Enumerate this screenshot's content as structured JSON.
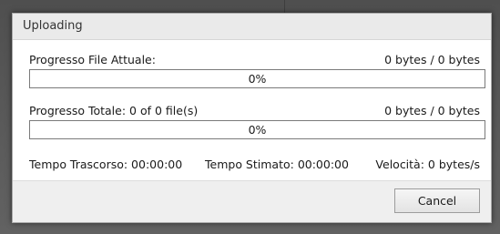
{
  "dialog": {
    "title": "Uploading"
  },
  "current_file": {
    "label": "Progresso File Attuale:",
    "bytes": "0 bytes / 0 bytes",
    "progress_fraction": 0,
    "progress_text": "0%"
  },
  "total": {
    "label": "Progresso Totale: 0 of 0 file(s)",
    "bytes": "0 bytes / 0 bytes",
    "progress_fraction": 0,
    "progress_text": "0%"
  },
  "stats": {
    "elapsed": "Tempo Trascorso: 00:00:00",
    "estimated": "Tempo Stimato: 00:00:00",
    "speed": "Velocità: 0 bytes/s"
  },
  "footer": {
    "cancel_label": "Cancel"
  },
  "colors": {
    "progress_fill": "#06b025"
  }
}
